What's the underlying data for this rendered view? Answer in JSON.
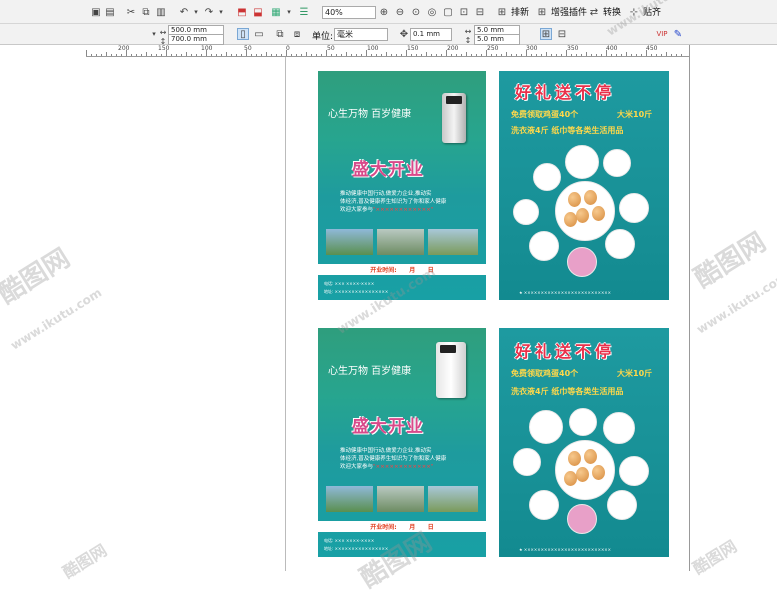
{
  "toolbar": {
    "zoom": "40%",
    "layout_label": "排新",
    "enhance_label": "增强插件",
    "convert_label": "转换",
    "paste_label": "贴齐"
  },
  "propbar": {
    "width": "500.0 mm",
    "height": "700.0 mm",
    "unit_label": "单位:",
    "unit_value": "毫米",
    "nudge": "0.1 mm",
    "dup_x": "5.0 mm",
    "dup_y": "5.0 mm"
  },
  "ruler": {
    "labels": [
      "200",
      "150",
      "100",
      "50",
      "0",
      "50",
      "100",
      "150",
      "200",
      "250",
      "300",
      "350",
      "400",
      "450"
    ]
  },
  "flyer_left": {
    "slogan": "心生万物 百岁健康",
    "title": "盛大开业",
    "body_line1": "推动健康中国行动,做爱力企业,推动实",
    "body_line2": "体经济,普及健康养生知识为了你和家人健康",
    "body_line3": "欢迎大家参与",
    "body_highlight": "\"××××××××××××\"",
    "open_label": "开业时间:",
    "month": "月",
    "day": "日",
    "phone": "电话: ××× ××××-××××",
    "address": "地址: ××××××××××××××××"
  },
  "flyer_right": {
    "title": "好礼送不停",
    "line1a": "免费领取鸡蛋40个",
    "line1b": "大米10斤",
    "line2": "洗衣液4斤 纸巾等各类生活用品",
    "footer": "★ ××××××××××××××××××××××××××"
  },
  "watermark": {
    "brand": "酷图网",
    "url": "www.ikutu.com"
  },
  "colors": {
    "teal": "#1a9aa0",
    "title_pink": "#d84a8a",
    "gift_red": "#e8304a",
    "gift_yellow": "#ffd84a"
  }
}
